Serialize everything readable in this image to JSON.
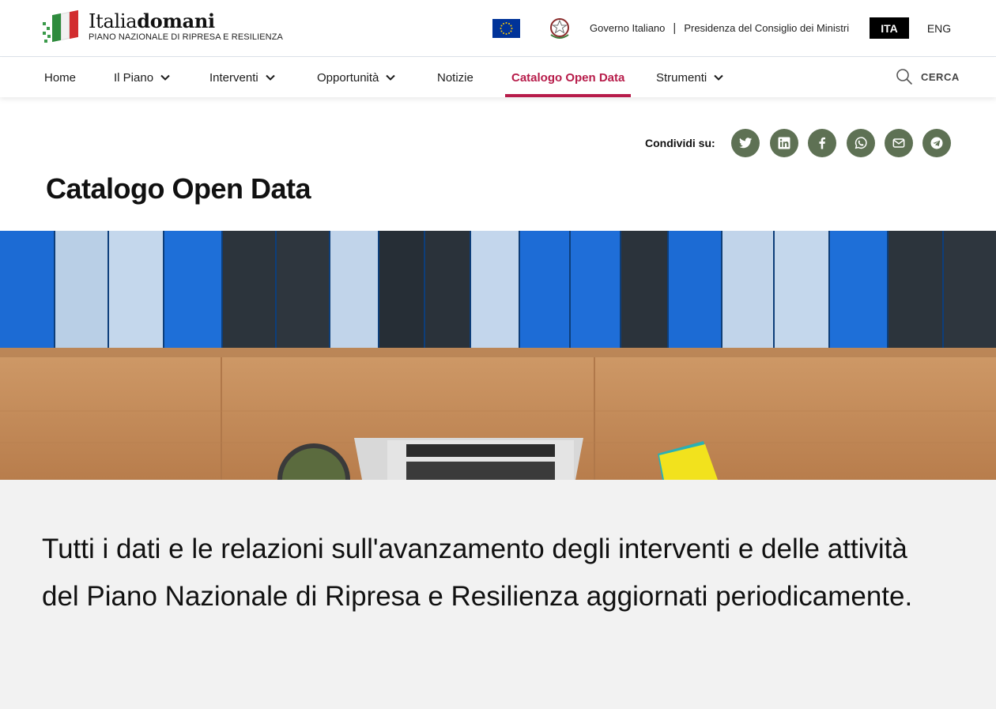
{
  "header": {
    "brand_regular": "Italia",
    "brand_bold": "domani",
    "subtitle": "PIANO NAZIONALE DI RIPRESA E RESILIENZA",
    "gov_link_1": "Governo Italiano",
    "separator": "|",
    "gov_link_2": "Presidenza del Consiglio dei Ministri",
    "lang_ita": "ITA",
    "lang_eng": "ENG"
  },
  "nav": {
    "items": [
      {
        "label": "Home",
        "dropdown": false
      },
      {
        "label": "Il Piano",
        "dropdown": true
      },
      {
        "label": "Interventi",
        "dropdown": true
      },
      {
        "label": "Opportunità",
        "dropdown": true
      },
      {
        "label": "Notizie",
        "dropdown": false
      },
      {
        "label": "Catalogo Open Data",
        "dropdown": false,
        "active": true
      },
      {
        "label": "Strumenti",
        "dropdown": true
      }
    ],
    "search_label": "CERCA"
  },
  "share": {
    "label": "Condividi su:",
    "icons": [
      "twitter-icon",
      "linkedin-icon",
      "facebook-icon",
      "whatsapp-icon",
      "email-icon",
      "telegram-icon"
    ]
  },
  "page": {
    "title": "Catalogo Open Data",
    "intro": "Tutti i dati e le relazioni sull'avanzamento degli interventi e delle attività del Piano Nazionale di Ripresa e Resilienza aggiornati periodicamente."
  },
  "colors": {
    "accent": "#b71c4a",
    "share_bg": "#5e7154",
    "intro_bg": "#f2f2f2"
  }
}
